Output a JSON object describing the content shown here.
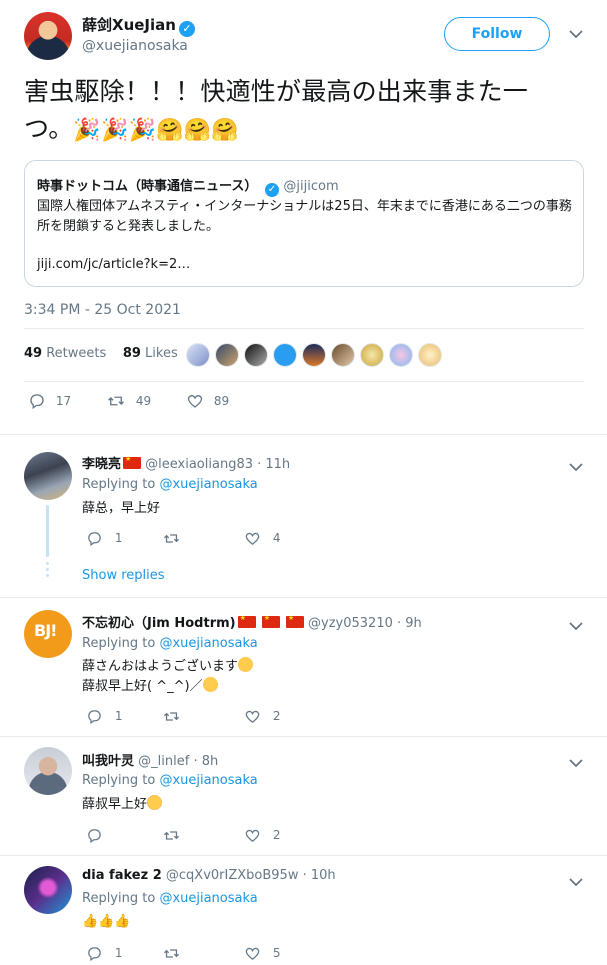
{
  "tweet": {
    "author_name": "薛剑XueJian",
    "author_handle": "@xuejianosaka",
    "follow_label": "Follow",
    "text_line1": "害虫駆除！！！快適性が最高の出来事また一",
    "text_line2": "つ。",
    "emojis": "🎉🎉🎉🤗🤗🤗",
    "timestamp": "3:34 PM - 25 Oct 2021",
    "retweets_count": "49",
    "retweets_label": "Retweets",
    "likes_count": "89",
    "likes_label": "Likes",
    "actions": {
      "replies": "17",
      "retweets": "49",
      "likes": "89"
    }
  },
  "quote": {
    "name": "時事ドットコム（時事通信ニュース）",
    "handle": "@jijicom",
    "text": "国際人権団体アムネスティ・インターナショナルは25日、年末までに香港にある二つの事務所を閉鎖すると発表しました。",
    "link": "jiji.com/jc/article?k=2…"
  },
  "replies": [
    {
      "name": "李晓亮",
      "handle": "@leexiaoliang83",
      "time": "· 11h",
      "replying_prefix": "Replying to",
      "replying_to": "@xuejianosaka",
      "text": "薛总，早上好",
      "counts": {
        "replies": "1",
        "retweets": "",
        "likes": "4"
      },
      "show_replies": "Show replies"
    },
    {
      "name": "不忘初心（Jim Hodtrm)",
      "handle": "@yzy053210",
      "time": "· 9h",
      "replying_prefix": "Replying to",
      "replying_to": "@xuejianosaka",
      "text_line1": "薛さんおはようございます",
      "text_line2": "薛叔早上好( ^_^)／",
      "counts": {
        "replies": "1",
        "retweets": "",
        "likes": "2"
      }
    },
    {
      "name": "叫我叶灵",
      "handle": "@_linlef",
      "time": "· 8h",
      "replying_prefix": "Replying to",
      "replying_to": "@xuejianosaka",
      "text": "薛叔早上好",
      "counts": {
        "replies": "",
        "retweets": "",
        "likes": "2"
      }
    },
    {
      "name": "dia fakez 2",
      "handle": "@cqXv0rIZXboB95w",
      "time": "· 10h",
      "replying_prefix": "Replying to",
      "replying_to": "@xuejianosaka",
      "text": "👍👍👍",
      "counts": {
        "replies": "1",
        "retweets": "",
        "likes": "5"
      }
    }
  ],
  "colors": {
    "accent": "#1da1f2",
    "link": "#1b95e0",
    "muted": "#657786",
    "border": "#e6ecf0"
  }
}
